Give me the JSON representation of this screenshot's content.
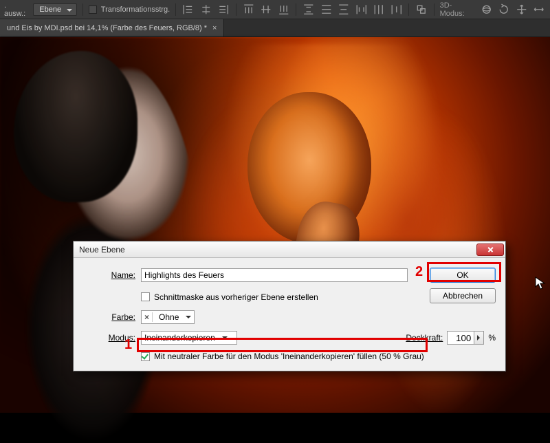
{
  "optbar": {
    "ausw_label": ". ausw.:",
    "layer_dd": "Ebene",
    "transform_label": "Transformationsstrg.",
    "mode3d_label": "3D-Modus:"
  },
  "tab": {
    "title": "und Eis by MDI.psd bei 14,1% (Farbe des Feuers, RGB/8) *",
    "close": "×"
  },
  "dialog": {
    "title": "Neue Ebene",
    "name_label": "Name:",
    "name_value": "Highlights des Feuers",
    "clipmask_label": "Schnittmaske aus vorheriger Ebene erstellen",
    "color_label": "Farbe:",
    "color_value": "Ohne",
    "color_x": "×",
    "mode_label": "Modus:",
    "mode_value": "Ineinanderkopieren",
    "opacity_label": "Deckkraft:",
    "opacity_value": "100",
    "opacity_pct": "%",
    "fill_label": "Mit neutraler Farbe für den Modus 'Ineinanderkopieren' füllen (50 % Grau)",
    "ok": "OK",
    "cancel": "Abbrechen"
  },
  "annotations": {
    "n1": "1",
    "n2": "2"
  }
}
